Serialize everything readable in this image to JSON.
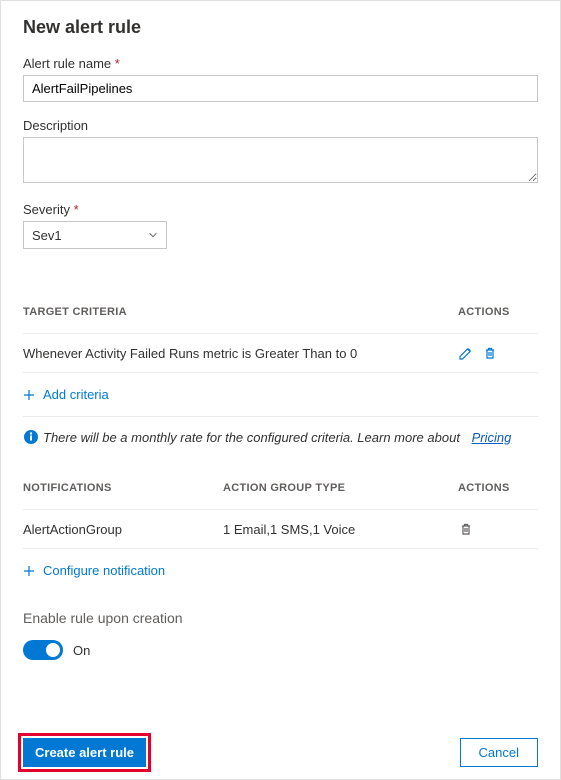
{
  "title": "New alert rule",
  "fields": {
    "name_label": "Alert rule name",
    "name_value": "AlertFailPipelines",
    "desc_label": "Description",
    "desc_value": "",
    "severity_label": "Severity",
    "severity_value": "Sev1"
  },
  "criteria": {
    "header_target": "TARGET CRITERIA",
    "header_actions": "ACTIONS",
    "row_text": "Whenever Activity Failed Runs metric is Greater Than to 0",
    "add_label": "Add criteria",
    "info_text": "There will be a monthly rate for the configured criteria. Learn more about",
    "pricing_link": "Pricing"
  },
  "notifications": {
    "header_notif": "NOTIFICATIONS",
    "header_type": "ACTION GROUP TYPE",
    "header_actions": "ACTIONS",
    "row_name": "AlertActionGroup",
    "row_type": "1 Email,1 SMS,1 Voice",
    "configure_label": "Configure notification"
  },
  "enable": {
    "label": "Enable rule upon creation",
    "state_label": "On"
  },
  "footer": {
    "create": "Create alert rule",
    "cancel": "Cancel"
  }
}
